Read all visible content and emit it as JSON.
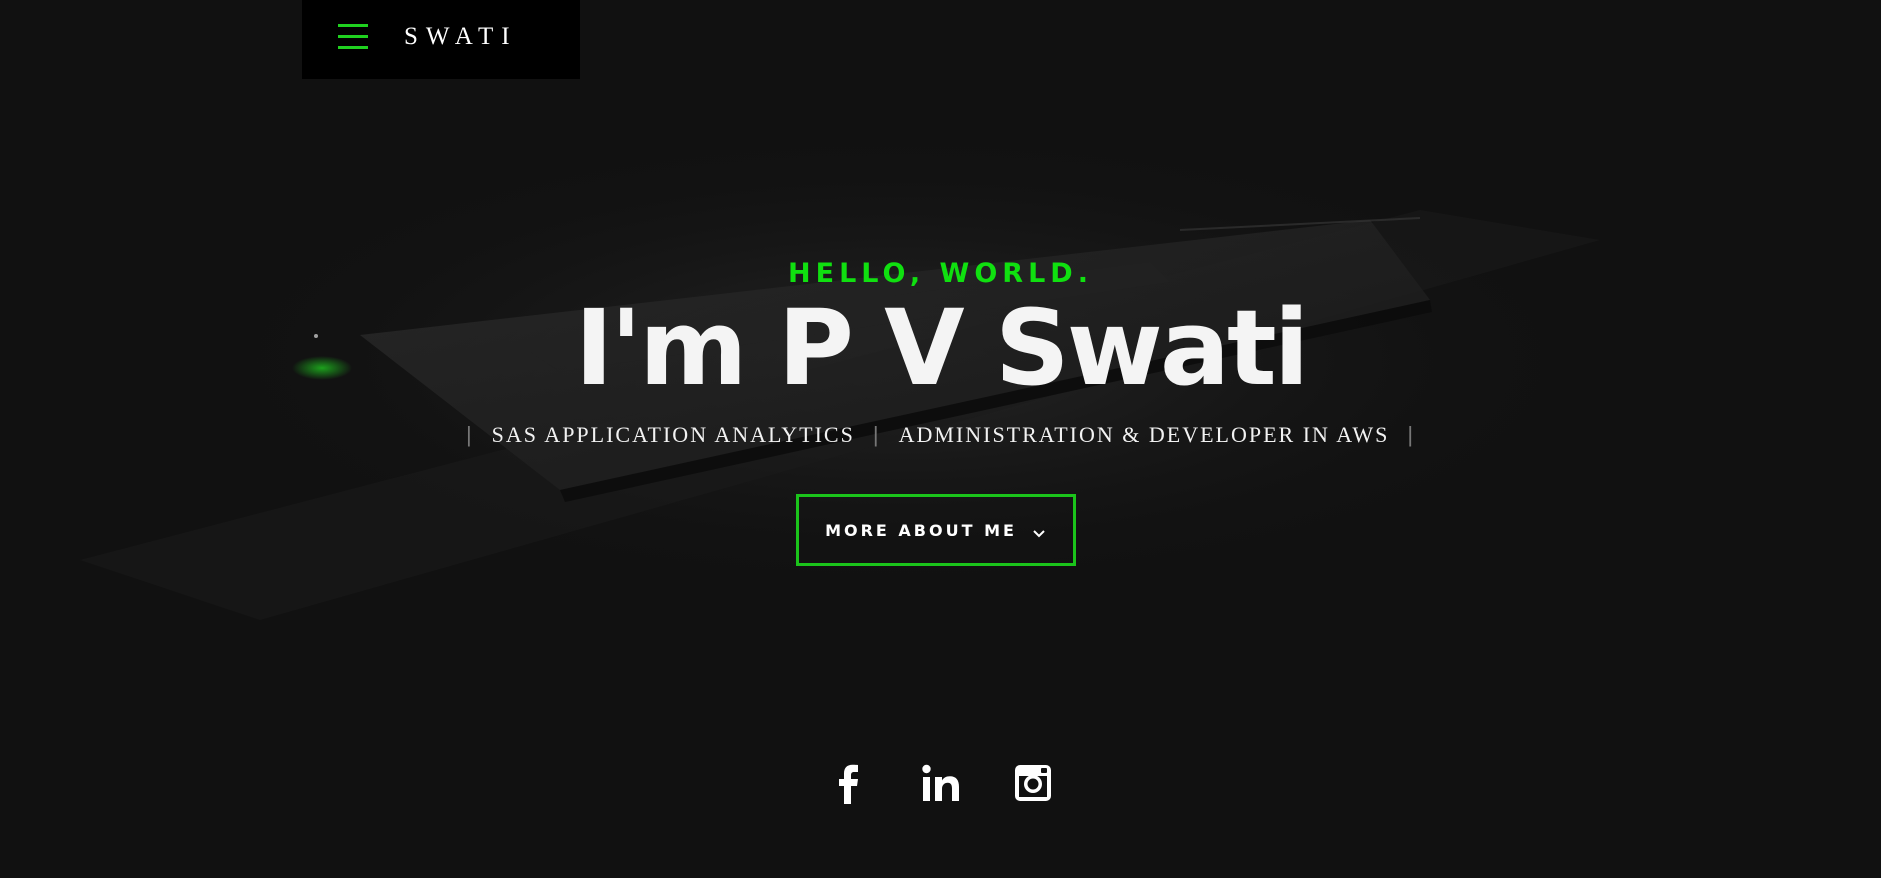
{
  "header": {
    "logo": "SWATI",
    "menu_icon": "hamburger-menu-icon",
    "accent_color": "#1fd11f"
  },
  "hero": {
    "greeting": "HELLO, WORLD.",
    "name": "I'm P V Swati",
    "roles": [
      "SAS APPLICATION ANALYTICS",
      "ADMINISTRATION & DEVELOPER IN AWS"
    ],
    "cta_label": "MORE ABOUT ME",
    "cta_icon": "chevron-down-icon"
  },
  "social": {
    "links": [
      {
        "icon": "facebook-icon"
      },
      {
        "icon": "linkedin-icon"
      },
      {
        "icon": "instagram-icon"
      }
    ]
  },
  "colors": {
    "background": "#111111",
    "accent": "#10e010",
    "text": "#f4f4f4"
  }
}
